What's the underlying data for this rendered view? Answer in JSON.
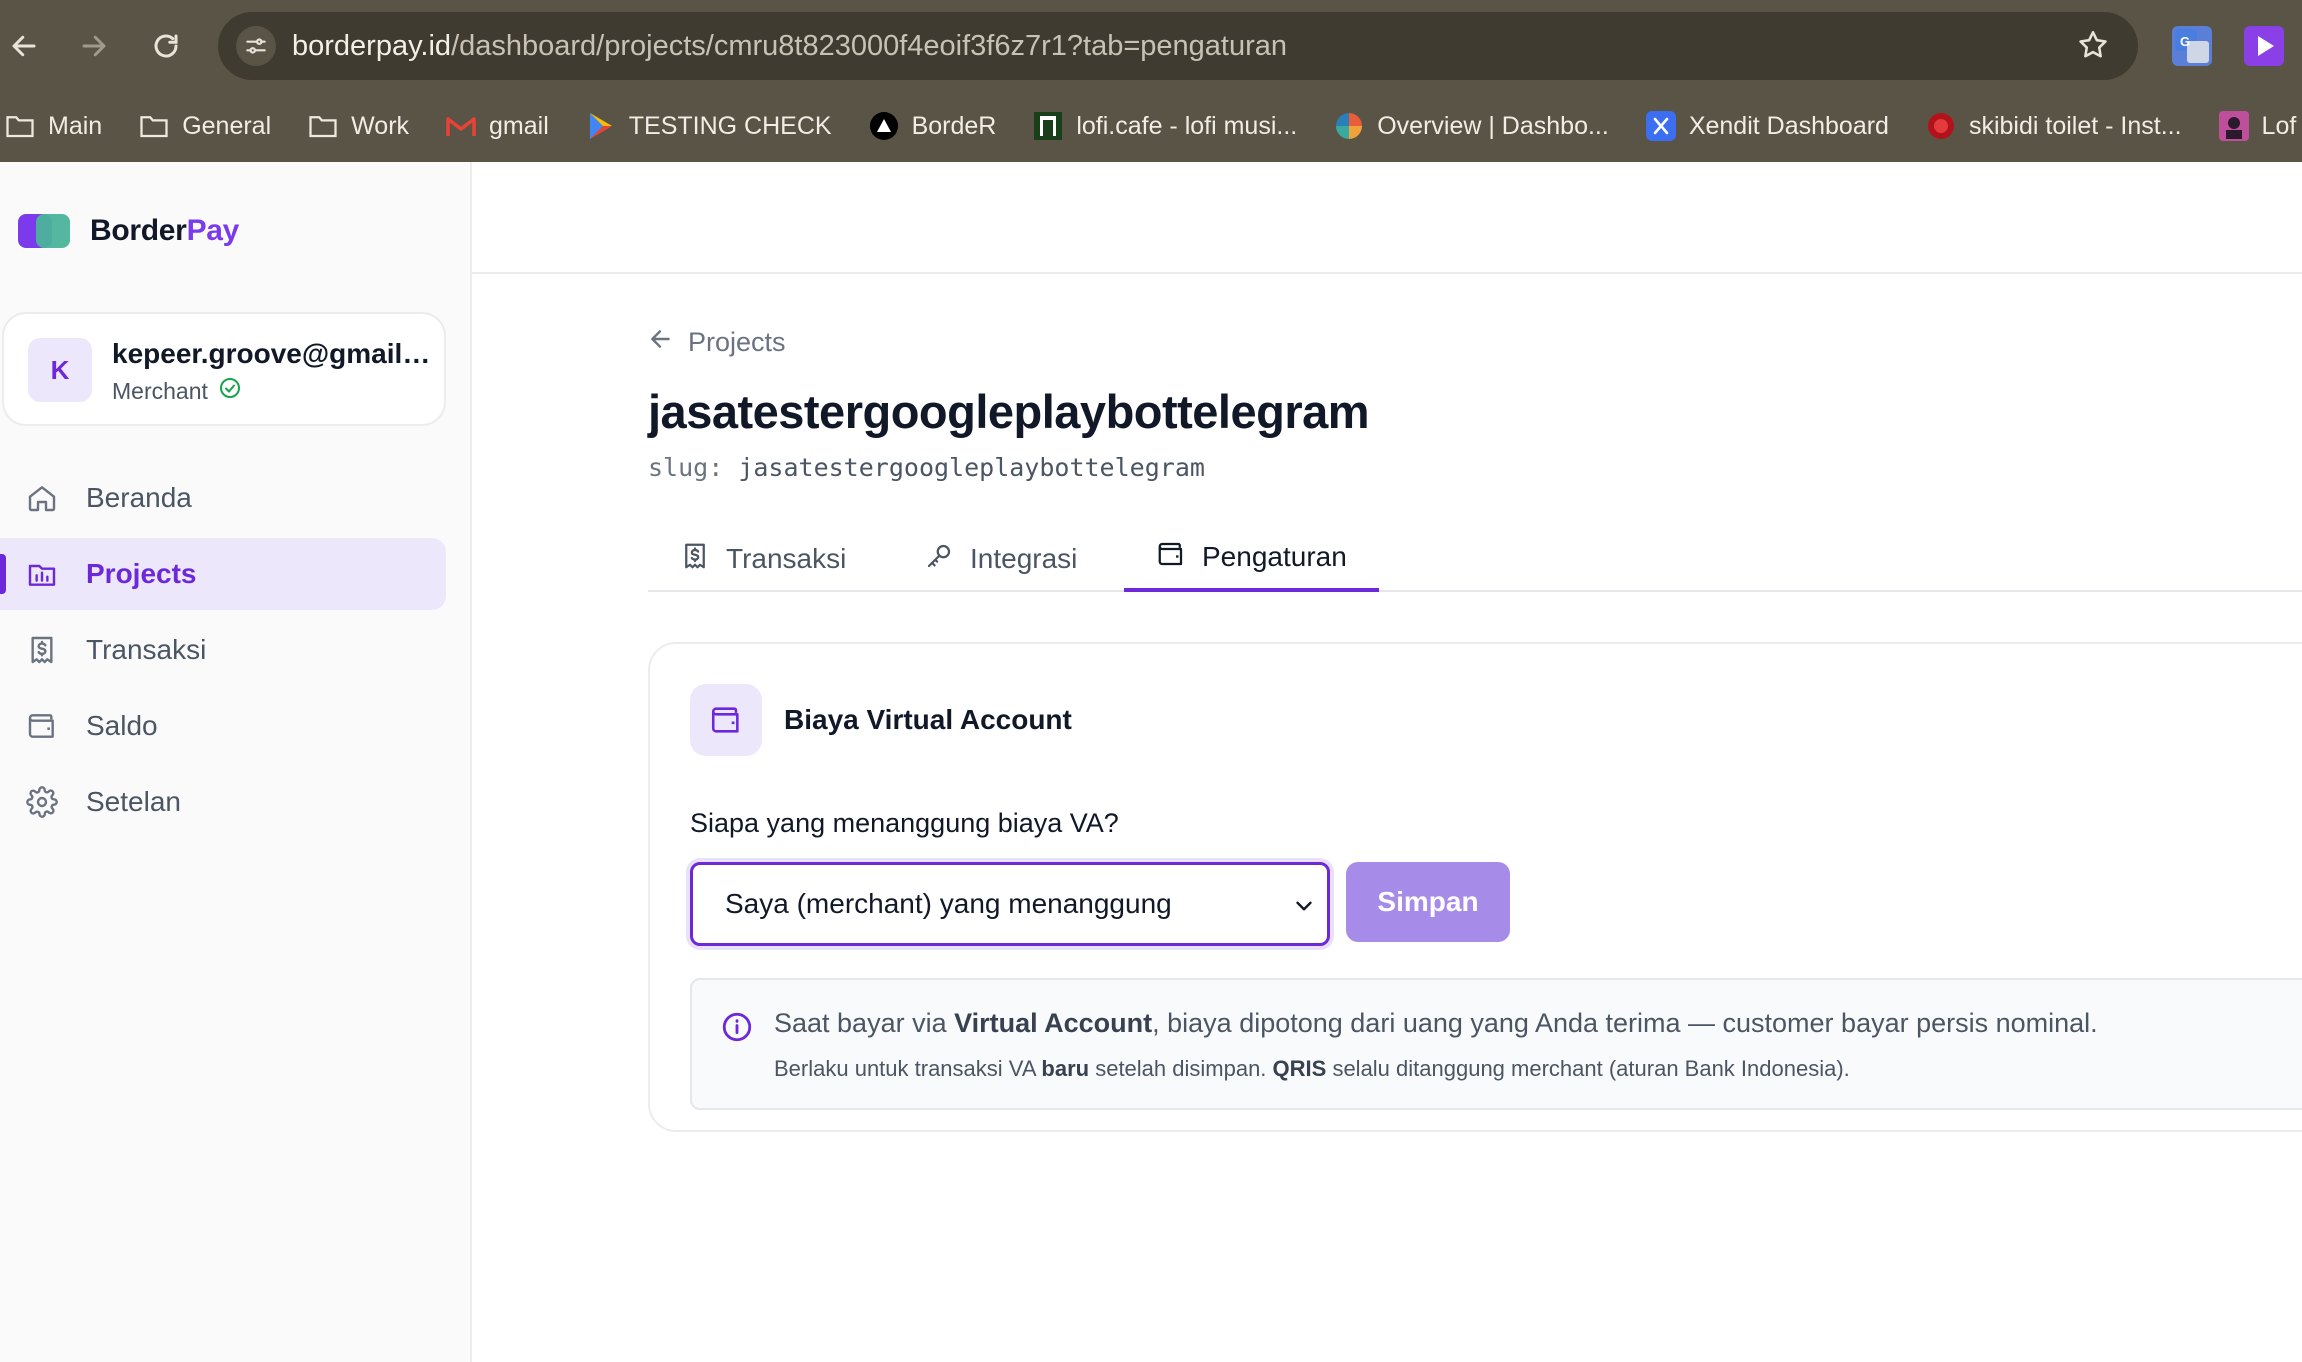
{
  "browser": {
    "url_host": "borderpay.id",
    "url_path": "/dashboard/projects/cmru8t823000f4eoif3f6z7r1?tab=pengaturan",
    "bookmarks": [
      {
        "label": "Main",
        "icon": "folder-icon"
      },
      {
        "label": "General",
        "icon": "folder-icon"
      },
      {
        "label": "Work",
        "icon": "folder-icon"
      },
      {
        "label": "gmail",
        "icon": "gmail-icon"
      },
      {
        "label": "TESTING CHECK",
        "icon": "play-store-icon"
      },
      {
        "label": "BordeR",
        "icon": "triangle-logo-icon"
      },
      {
        "label": "lofi.cafe - lofi musi...",
        "icon": "lofi-icon"
      },
      {
        "label": "Overview | Dashbo...",
        "icon": "dashboard-logo-icon"
      },
      {
        "label": "Xendit Dashboard",
        "icon": "xendit-icon"
      },
      {
        "label": "skibidi toilet - Inst...",
        "icon": "red-circle-icon"
      },
      {
        "label": "Lof",
        "icon": "image-icon"
      }
    ]
  },
  "brand": {
    "name_part1": "Border",
    "name_part2": "Pay",
    "accent": "#7c3aed"
  },
  "user": {
    "initial": "K",
    "email": "kepeer.groove@gmail.com",
    "role": "Merchant"
  },
  "sidebar": {
    "items": [
      {
        "label": "Beranda",
        "icon": "home-icon",
        "active": false
      },
      {
        "label": "Projects",
        "icon": "projects-icon",
        "active": true
      },
      {
        "label": "Transaksi",
        "icon": "receipt-icon",
        "active": false
      },
      {
        "label": "Saldo",
        "icon": "wallet-icon",
        "active": false
      },
      {
        "label": "Setelan",
        "icon": "gear-icon",
        "active": false
      }
    ]
  },
  "project": {
    "back_label": "Projects",
    "title": "jasatestergoogleplaybottelegram",
    "slug_label": "slug:",
    "slug_value": "jasatestergoogleplaybottelegram"
  },
  "tabs": [
    {
      "label": "Transaksi",
      "icon": "receipt-icon",
      "active": false
    },
    {
      "label": "Integrasi",
      "icon": "key-icon",
      "active": false
    },
    {
      "label": "Pengaturan",
      "icon": "wallet-icon",
      "active": true
    }
  ],
  "settings": {
    "card_title": "Biaya Virtual Account",
    "question": "Siapa yang menanggung biaya VA?",
    "selected_option": "Saya (merchant) yang menanggung",
    "save_label": "Simpan",
    "info_line1_a": "Saat bayar via ",
    "info_line1_b": "Virtual Account",
    "info_line1_c": ", biaya dipotong dari uang yang Anda terima — customer bayar persis nominal.",
    "info_line2_a": "Berlaku untuk transaksi VA ",
    "info_line2_b": "baru",
    "info_line2_c": " setelah disimpan. ",
    "info_line2_d": "QRIS",
    "info_line2_e": " selalu ditanggung merchant (aturan Bank Indonesia)."
  }
}
